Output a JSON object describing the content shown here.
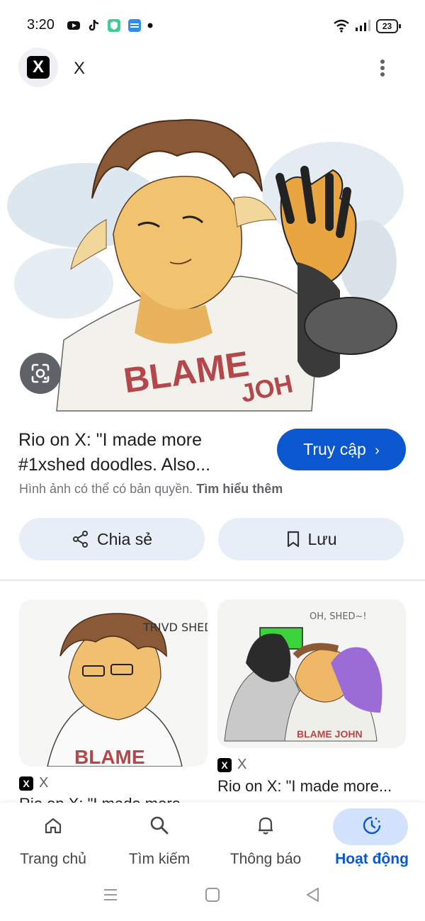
{
  "status_bar": {
    "time": "3:20",
    "battery": "23",
    "icons": [
      "youtube-icon",
      "tiktok-icon",
      "vpn-shield-icon",
      "noveltoon-icon",
      "dot-icon",
      "wifi-icon",
      "signal-icon"
    ]
  },
  "header": {
    "site_name": "X",
    "logo_letter": "X"
  },
  "main_image": {
    "shirt_text_line1": "BLAME",
    "shirt_text_line2": "JOH"
  },
  "result": {
    "title": "Rio on X: \"I made more #1xshed doodles. Also...",
    "visit_label": "Truy cập",
    "copyright_text": "Hình ảnh có thể có bản quyền.",
    "learn_more": "Tìm hiểu thêm",
    "share_label": "Chia sẻ",
    "save_label": "Lưu"
  },
  "related": [
    {
      "source": "X",
      "title": "Rio on X: \"I made more...",
      "art_text": "TRIVD SHEDD",
      "shirt_text": "BLAME"
    },
    {
      "source": "X",
      "title": "Rio on X: \"I made more...",
      "art_text": "OH, SHED~!",
      "shirt_text": "BLAME JOHN"
    }
  ],
  "bottom_nav": {
    "items": [
      {
        "label": "Trang chủ",
        "icon": "home-icon"
      },
      {
        "label": "Tìm kiếm",
        "icon": "search-icon"
      },
      {
        "label": "Thông báo",
        "icon": "bell-icon"
      },
      {
        "label": "Hoạt động",
        "icon": "activity-icon",
        "active": true
      }
    ]
  },
  "colors": {
    "accent": "#0b57d0",
    "pill_bg": "#e8eef8",
    "active_pill": "#d3e3fd"
  }
}
